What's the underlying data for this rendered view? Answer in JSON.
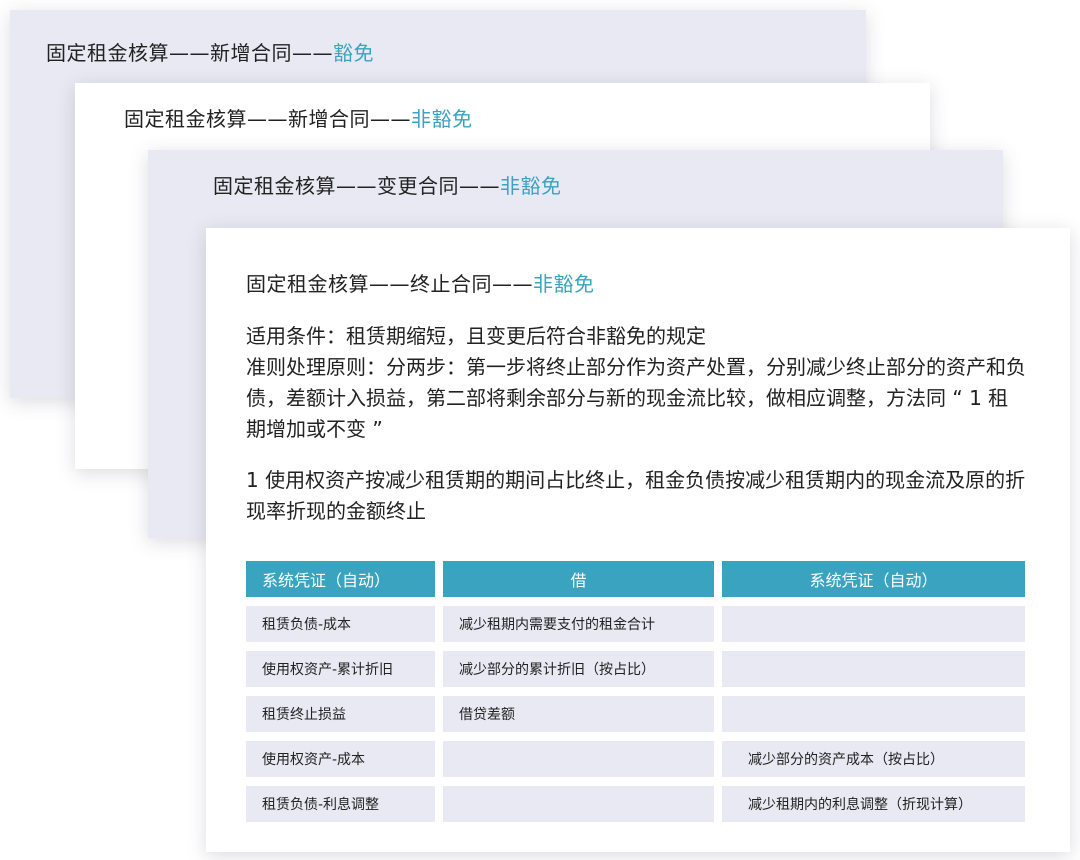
{
  "cards": [
    {
      "prefix": "固定租金核算——新增合同——",
      "accent": "豁免"
    },
    {
      "prefix": "固定租金核算——新增合同——",
      "accent": "非豁免"
    },
    {
      "prefix": "固定租金核算——变更合同——",
      "accent": "非豁免"
    },
    {
      "prefix": "固定租金核算——终止合同——",
      "accent": "非豁免"
    }
  ],
  "content": {
    "condition": "适用条件：租赁期缩短，且变更后符合非豁免的规定",
    "principle": "准则处理原则：分两步：第一步将终止部分作为资产处置，分别减少终止部分的资产和负债，差额计入损益，第二部将剩余部分与新的现金流比较，做相应调整，方法同 “ 1 租期增加或不变 ”",
    "note": "1 使用权资产按减少租赁期的期间占比终止，租金负债按减少租赁期内的现金流及原的折现率折现的金额终止"
  },
  "table": {
    "headers": [
      "系统凭证（自动）",
      "借",
      "系统凭证（自动）"
    ],
    "rows": [
      [
        "租赁负债-成本",
        "减少租期内需要支付的租金合计",
        ""
      ],
      [
        "使用权资产-累计折旧",
        "减少部分的累计折旧（按占比）",
        ""
      ],
      [
        "租赁终止损益",
        "借贷差额",
        ""
      ],
      [
        "使用权资产-成本",
        "",
        "减少部分的资产成本（按占比）"
      ],
      [
        "租赁负债-利息调整",
        "",
        "减少租期内的利息调整（折现计算）"
      ]
    ]
  },
  "colors": {
    "accent": "#3aa3c0",
    "card_gray": "#e9e9f3",
    "header_bg": "#3aa3c0"
  }
}
